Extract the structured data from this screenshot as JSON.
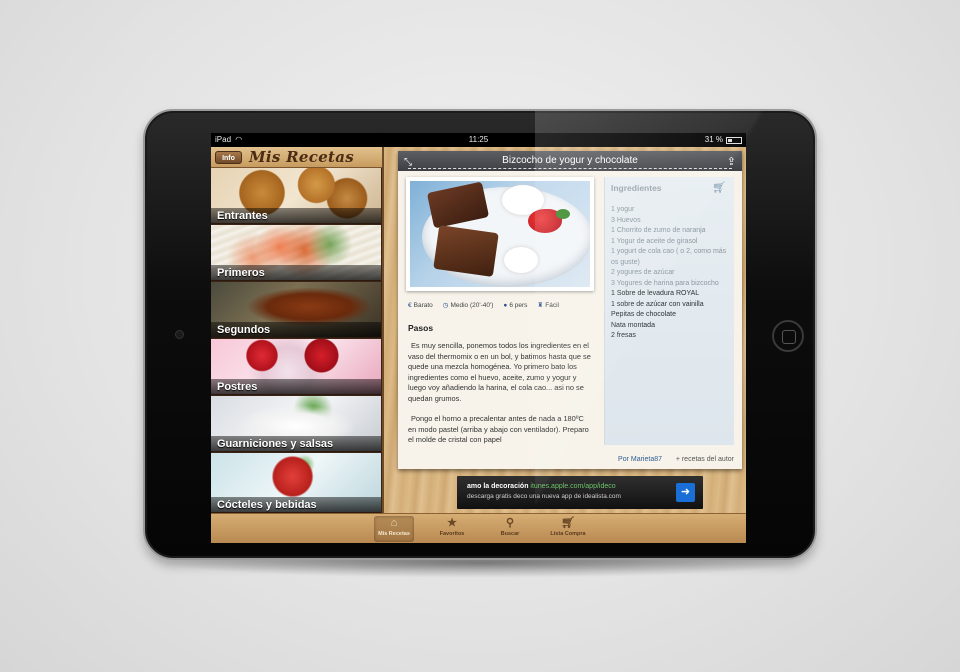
{
  "status": {
    "device": "iPad",
    "time": "11:25",
    "battery": "31 %"
  },
  "sidebar": {
    "info_label": "Info",
    "title": "Mis Recetas",
    "categories": [
      {
        "label": "Entrantes"
      },
      {
        "label": "Primeros"
      },
      {
        "label": "Segundos"
      },
      {
        "label": "Postres"
      },
      {
        "label": "Guarniciones y salsas"
      },
      {
        "label": "Cócteles y bebidas"
      }
    ]
  },
  "recipe": {
    "title": "Bizcocho de yogur y chocolate",
    "meta": {
      "price": "Barato",
      "time": "Medio (20'-40')",
      "servings": "6 pers",
      "difficulty": "Fácil"
    },
    "steps_title": "Pasos",
    "steps": [
      "Es muy sencilla, ponemos todos los ingredientes en el vaso del thermomix o en un bol, y batimos hasta que se quede una mezcla homogénea. Yo primero bato los ingredientes como el huevo, aceite, zumo y yogur y luego voy añadiendo la harina, el cola cao... asi no se quedan grumos.",
      "Pongo el horno a precalentar antes de nada a 180ºC en modo pastel (arriba y abajo con ventilador). Preparo el molde de cristal con papel"
    ],
    "ingredients_title": "Ingredientes",
    "ingredients": [
      "1 yogur",
      "3 Huevos",
      "1 Chorrito de zumo de naranja",
      "1 Yogur de aceite de girasol",
      "1 yogurt de cola cao ( o 2, como más os guste)",
      "2 yogures de azúcar",
      "3 Yogures de harina para bizcocho",
      "1 Sobre de levadura ROYAL",
      "1 sobre de azúcar con vainilla",
      "Pepitas de chocolate",
      "Nata montada",
      "2 fresas"
    ],
    "author": "Por Marieta87",
    "more_recipes": "+ recetas del autor"
  },
  "ad": {
    "title": "amo la decoración",
    "url": "itunes.apple.com/app/ideco",
    "text": "descarga gratis deco una nueva app de idealista.com"
  },
  "tabs": [
    {
      "label": "Mis Recetas",
      "icon": "home-icon"
    },
    {
      "label": "Favoritos",
      "icon": "star-icon"
    },
    {
      "label": "Buscar",
      "icon": "search-icon"
    },
    {
      "label": "Lista Compra",
      "icon": "cart-icon"
    }
  ],
  "colors": {
    "header_dark": "#3d3f44",
    "wood": "#d3ae78",
    "link": "#2f5d93",
    "ad_button": "#1a6fd6"
  }
}
